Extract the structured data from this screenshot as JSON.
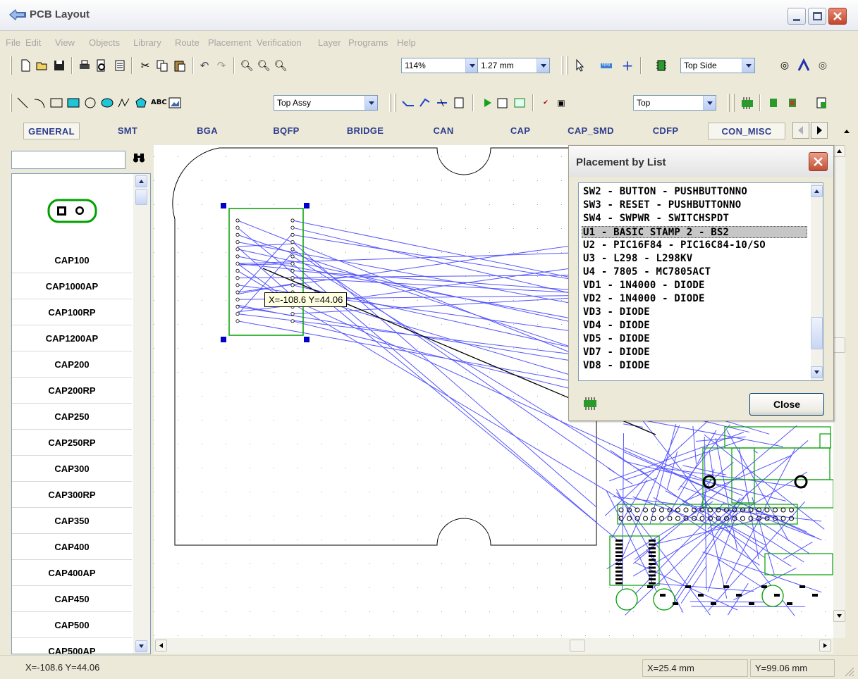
{
  "window": {
    "title": "PCB Layout"
  },
  "menu": [
    "File",
    "Edit",
    "View",
    "Objects",
    "Library",
    "Route",
    "Placement",
    "Verification",
    "Layer",
    "Programs",
    "Help"
  ],
  "toolbar1": {
    "zoom_value": "114%",
    "grid_value": "1.27 mm",
    "side_value": "Top Side"
  },
  "toolbar2": {
    "layer_assy_value": "Top Assy",
    "layer_value": "Top",
    "text_tool_label": "ABC"
  },
  "library_tabs": [
    "GENERAL",
    "SMT",
    "BGA",
    "BQFP",
    "BRIDGE",
    "CAN",
    "CAP",
    "CAP_SMD",
    "CDFP",
    "CON_MISC"
  ],
  "library_list": {
    "search_value": "",
    "items": [
      "CAP100",
      "CAP1000AP",
      "CAP100RP",
      "CAP1200AP",
      "CAP200",
      "CAP200RP",
      "CAP250",
      "CAP250RP",
      "CAP300",
      "CAP300RP",
      "CAP350",
      "CAP400",
      "CAP400AP",
      "CAP450",
      "CAP500",
      "CAP500AP"
    ]
  },
  "canvas": {
    "cursor_tooltip": "X=-108.6  Y=44.06"
  },
  "dialog": {
    "title": "Placement by List",
    "items": [
      "SW2 - BUTTON - PUSHBUTTONNO",
      "SW3 - RESET - PUSHBUTTONNO",
      "SW4 - SWPWR - SWITCHSPDT",
      "U1 - BASIC STAMP 2 - BS2",
      "U2 - PIC16F84 - PIC16C84-10/SO",
      "U3 - L298 - L298KV",
      "U4 - 7805 - MC7805ACT",
      "VD1 - 1N4000 - DIODE",
      "VD2 - 1N4000 - DIODE",
      "VD3 - DIODE",
      "VD4 - DIODE",
      "VD5 - DIODE",
      "VD7 - DIODE",
      "VD8 - DIODE"
    ],
    "selected_index": 3,
    "close_label": "Close"
  },
  "status": {
    "cursor": "X=-108.6  Y=44.06",
    "x": "X=25.4 mm",
    "y": "Y=99.06 mm"
  },
  "colors": {
    "ratsnest": "#5555ff",
    "component_outline": "#00a000",
    "selection_handle": "#0000cc"
  }
}
